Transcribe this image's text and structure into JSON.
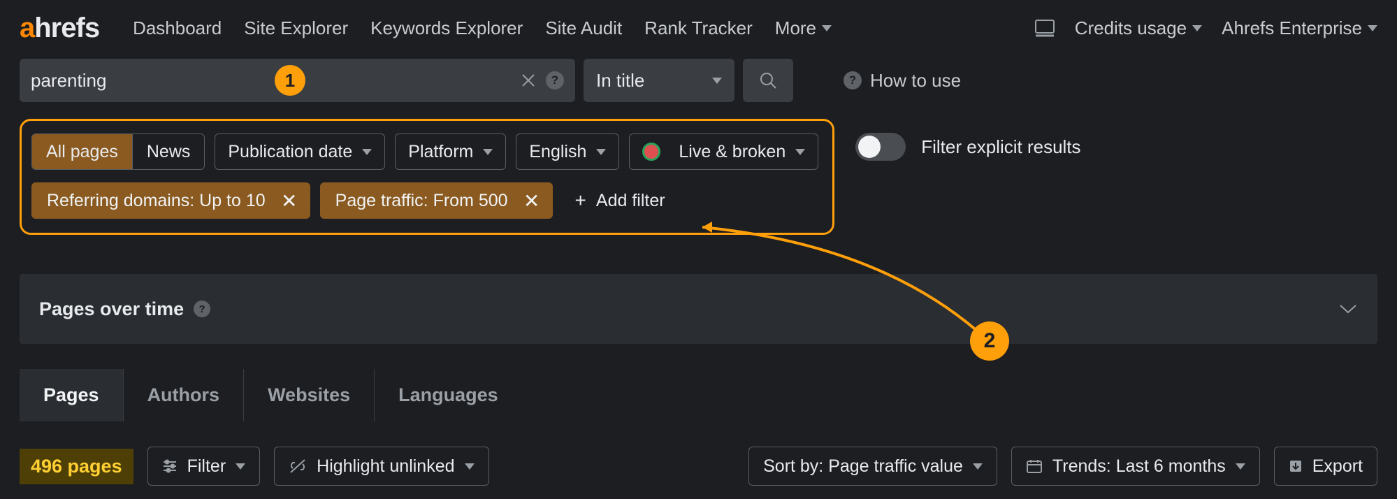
{
  "brand": {
    "a": "a",
    "rest": "hrefs"
  },
  "nav": {
    "items": [
      "Dashboard",
      "Site Explorer",
      "Keywords Explorer",
      "Site Audit",
      "Rank Tracker"
    ],
    "more": "More",
    "credits": "Credits usage",
    "account": "Ahrefs Enterprise"
  },
  "search": {
    "value": "parenting",
    "badge1": "1",
    "mode": "In title",
    "howto": "How to use"
  },
  "filters": {
    "segment": {
      "all": "All pages",
      "news": "News"
    },
    "pubdate": "Publication date",
    "platform": "Platform",
    "language": "English",
    "livebroken": "Live & broken",
    "chips": {
      "refdomains": "Referring domains: Up to 10",
      "pagetraffic": "Page traffic: From 500"
    },
    "add": "Add filter",
    "explicit": "Filter explicit results",
    "badge2": "2"
  },
  "panel": {
    "title": "Pages over time"
  },
  "tabs": [
    "Pages",
    "Authors",
    "Websites",
    "Languages"
  ],
  "toolbar": {
    "count": "496 pages",
    "filter": "Filter",
    "highlight": "Highlight unlinked",
    "sort": "Sort by: Page traffic value",
    "trends": "Trends: Last 6 months",
    "export": "Export"
  }
}
